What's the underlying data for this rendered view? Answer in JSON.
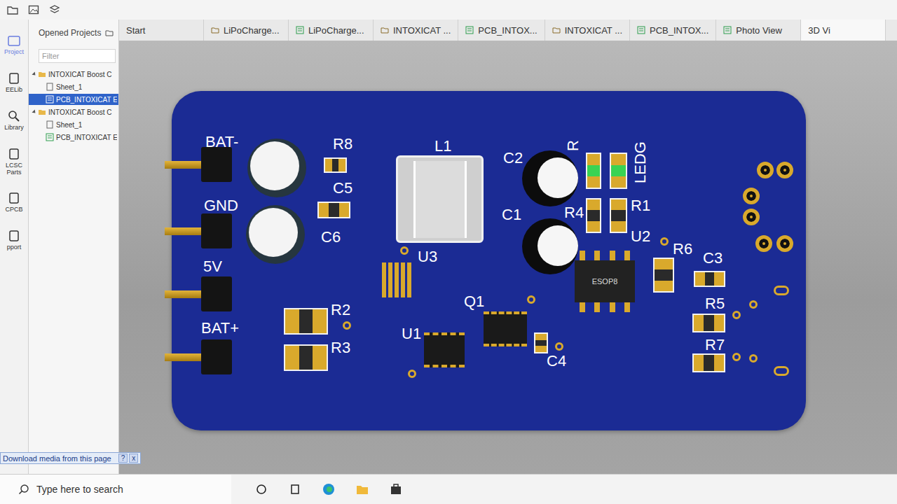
{
  "sidebar": {
    "items": [
      {
        "label": "Project",
        "selected": true
      },
      {
        "label": "EELib",
        "selected": false
      },
      {
        "label": "Library",
        "selected": false
      },
      {
        "label": "LCSC Parts",
        "selected": false
      },
      {
        "label": "CPCB",
        "selected": false
      },
      {
        "label": "pport",
        "selected": false
      }
    ]
  },
  "projects": {
    "title": "Opened Projects",
    "filter_placeholder": "Filter",
    "tree": [
      {
        "label": "INTOXICAT Boost C",
        "kind": "folder",
        "selected": false
      },
      {
        "label": "Sheet_1",
        "kind": "sheet",
        "selected": false
      },
      {
        "label": "PCB_INTOXICAT E",
        "kind": "pcb",
        "selected": true
      },
      {
        "label": "INTOXICAT Boost C",
        "kind": "folder",
        "selected": false
      },
      {
        "label": "Sheet_1",
        "kind": "sheet",
        "selected": false
      },
      {
        "label": "PCB_INTOXICAT E",
        "kind": "pcb",
        "selected": false
      }
    ]
  },
  "tabs": [
    {
      "label": "Start",
      "kind": "start",
      "selected": false
    },
    {
      "label": "LiPoCharge...",
      "kind": "folder",
      "selected": false
    },
    {
      "label": "LiPoCharge...",
      "kind": "pcb",
      "selected": false
    },
    {
      "label": "INTOXICAT ...",
      "kind": "folder",
      "selected": false
    },
    {
      "label": "PCB_INTOX...",
      "kind": "pcb",
      "selected": false
    },
    {
      "label": "INTOXICAT ...",
      "kind": "folder",
      "selected": false
    },
    {
      "label": "PCB_INTOX...",
      "kind": "pcb",
      "selected": false
    },
    {
      "label": "Photo View",
      "kind": "pcb",
      "selected": false
    },
    {
      "label": "3D Vi",
      "kind": "start",
      "selected": true
    }
  ],
  "pcb": {
    "labels": [
      "BAT-",
      "GND",
      "5V",
      "BAT+",
      "R8",
      "C5",
      "C6",
      "R2",
      "R3",
      "L1",
      "U3",
      "U1",
      "Q1",
      "C4",
      "C2",
      "C1",
      "R4",
      "R",
      "LEDG",
      "R1",
      "U2",
      "R6",
      "C3",
      "R5",
      "R7"
    ],
    "chip_marking": "ESOP8"
  },
  "download_bar": {
    "text": "Download media from this page",
    "buttons": [
      "?",
      "x"
    ]
  },
  "taskbar": {
    "search_placeholder": "Type here to search"
  }
}
